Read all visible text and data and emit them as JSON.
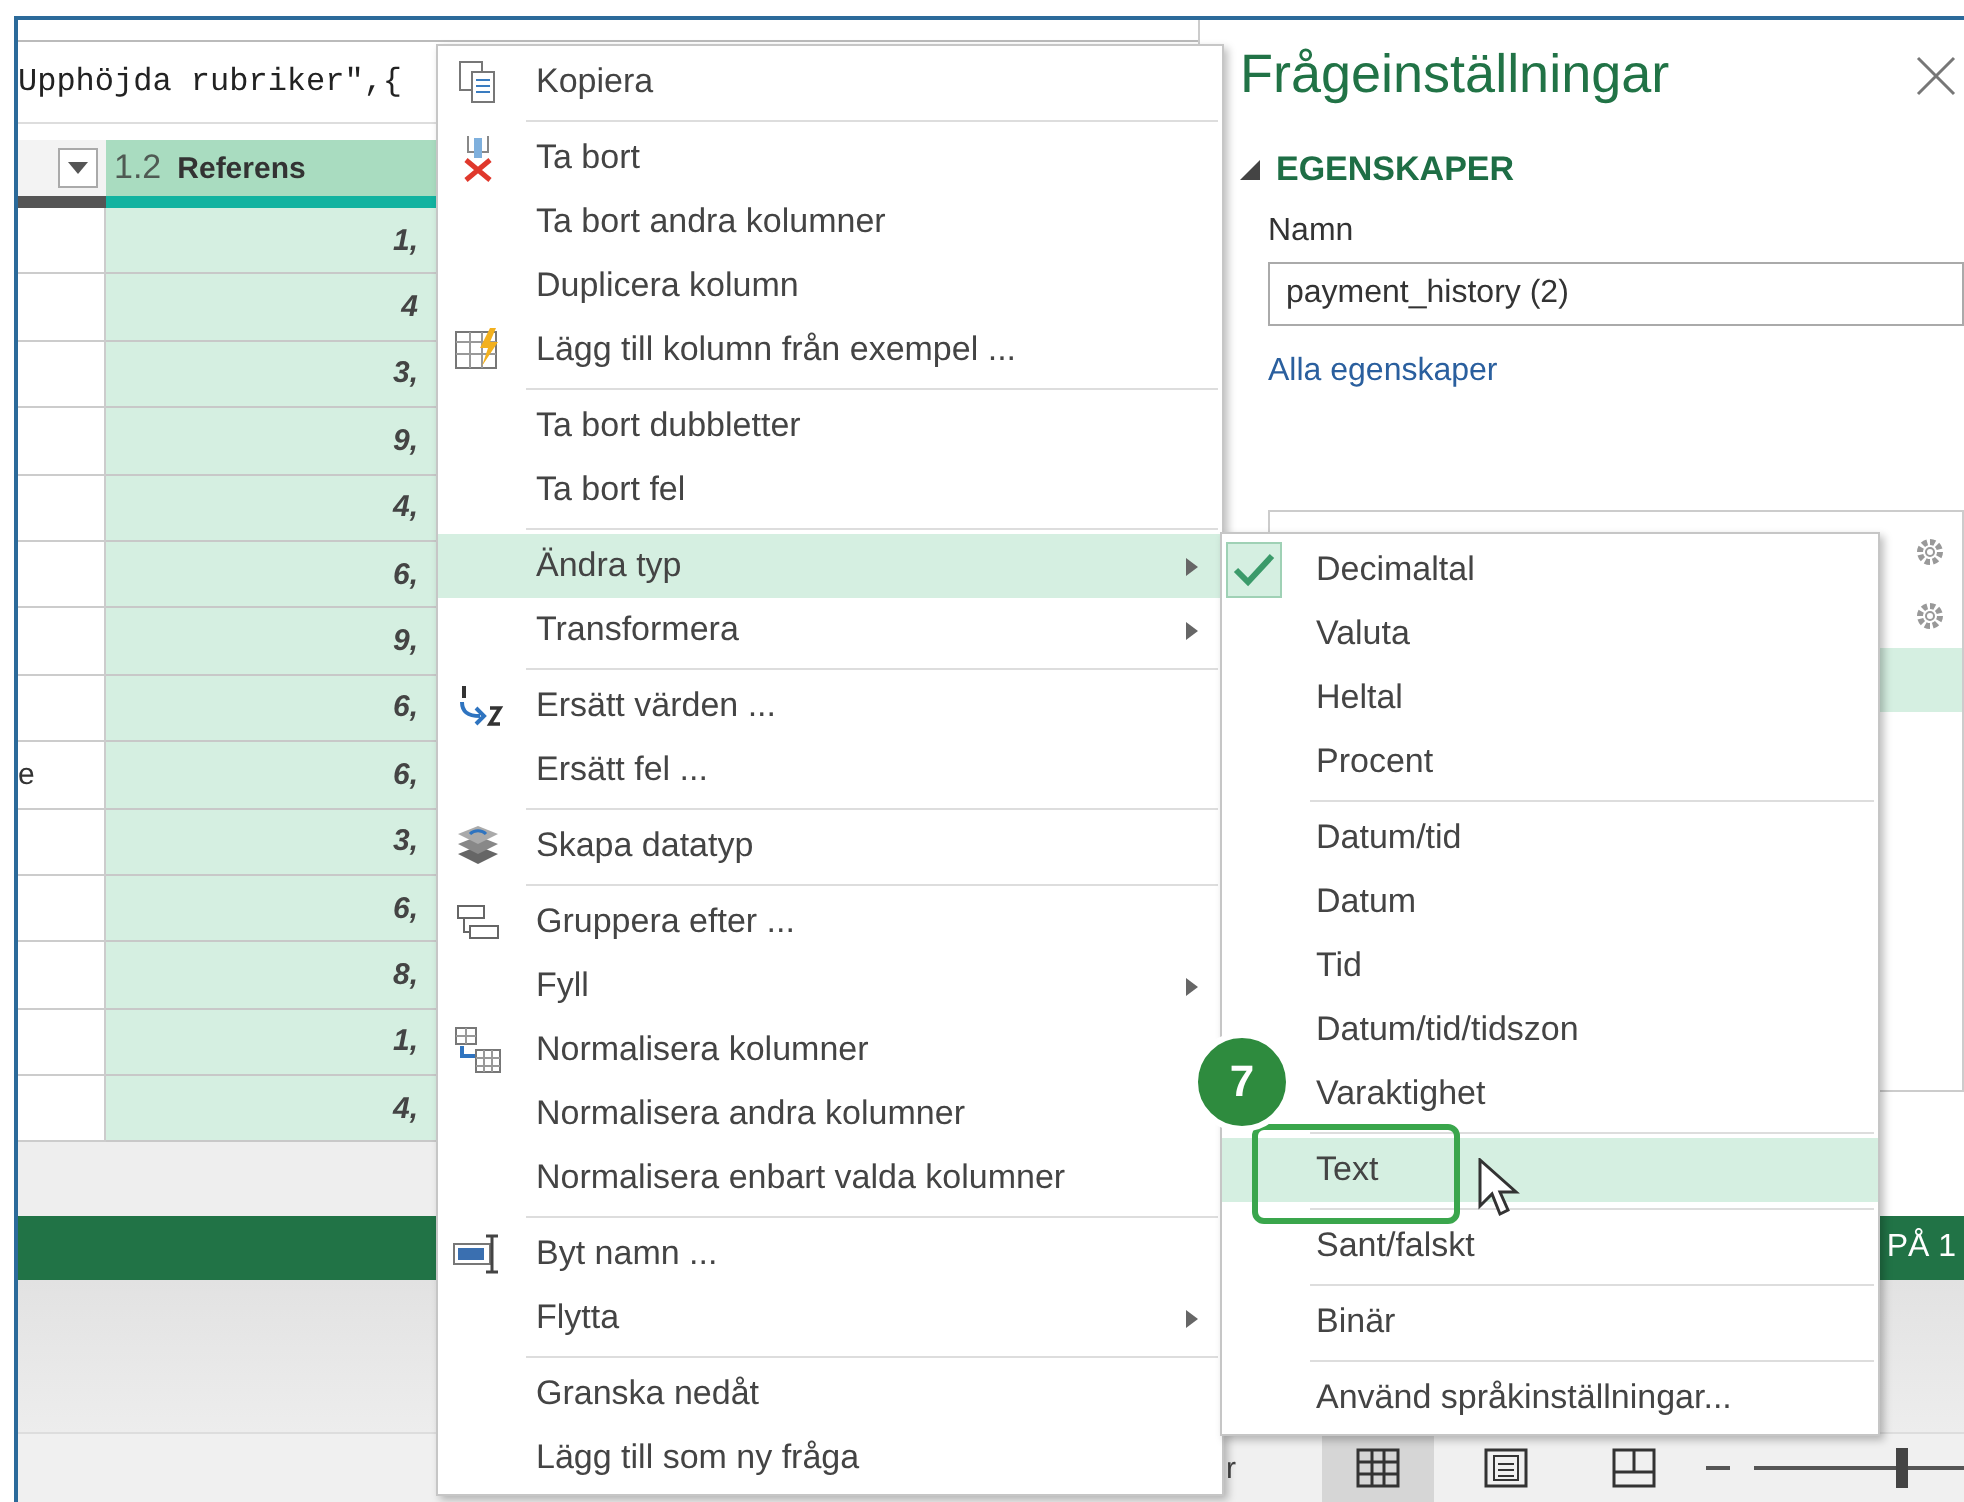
{
  "formula_bar": {
    "text": "Upphöjda rubriker\",{"
  },
  "table": {
    "column_2": {
      "type": "1.2",
      "name": "Referens",
      "selected": true
    },
    "rows": [
      {
        "column_2": "1,"
      },
      {
        "column_2": "4"
      },
      {
        "column_2": "3,"
      },
      {
        "column_2": "9,"
      },
      {
        "column_2": "4,"
      },
      {
        "column_2": "6,"
      },
      {
        "column_2": "9,"
      },
      {
        "column_2": "6,"
      },
      {
        "column_1": "e",
        "column_2": "6,"
      },
      {
        "column_2": "3,"
      },
      {
        "column_2": "6,"
      },
      {
        "column_2": "8,"
      },
      {
        "column_2": "1,"
      },
      {
        "column_2": "4,"
      }
    ]
  },
  "settings_pane": {
    "title": "Frågeinställningar",
    "properties": {
      "heading": "EGENSKAPER",
      "expanded": true,
      "name_label": "Namn",
      "name_value": "payment_history (2)",
      "link": "Alla egenskaper"
    },
    "steps": [
      {
        "has_settings": true,
        "selected": false
      },
      {
        "has_settings": true,
        "selected": false
      },
      {
        "has_settings": false,
        "selected": true
      }
    ]
  },
  "status_bar": {
    "text": "PÅ 1"
  },
  "bottom_bar": {
    "text": "r",
    "views": [
      {
        "selected": true
      },
      {
        "selected": false
      },
      {
        "selected": false
      }
    ],
    "zoom": {
      "level": 0.7
    }
  },
  "context_menu": {
    "items": [
      {
        "kind": "item",
        "label": "Kopiera",
        "icon": true,
        "submenu": false,
        "selected": false
      },
      {
        "kind": "separator"
      },
      {
        "kind": "item",
        "label": "Ta bort",
        "icon": true,
        "submenu": false,
        "selected": false
      },
      {
        "kind": "item",
        "label": "Ta bort andra kolumner",
        "icon": false,
        "submenu": false,
        "selected": false
      },
      {
        "kind": "item",
        "label": "Duplicera kolumn",
        "icon": false,
        "submenu": false,
        "selected": false
      },
      {
        "kind": "item",
        "label": "Lägg till kolumn från exempel ...",
        "icon": true,
        "submenu": false,
        "selected": false
      },
      {
        "kind": "separator"
      },
      {
        "kind": "item",
        "label": "Ta bort dubbletter",
        "icon": false,
        "submenu": false,
        "selected": false
      },
      {
        "kind": "item",
        "label": "Ta bort fel",
        "icon": false,
        "submenu": false,
        "selected": false
      },
      {
        "kind": "separator"
      },
      {
        "kind": "item",
        "label": "Ändra typ",
        "icon": false,
        "submenu": true,
        "selected": true
      },
      {
        "kind": "item",
        "label": "Transformera",
        "icon": false,
        "submenu": true,
        "selected": false
      },
      {
        "kind": "separator"
      },
      {
        "kind": "item",
        "label": "Ersätt värden ...",
        "icon": true,
        "submenu": false,
        "selected": false
      },
      {
        "kind": "item",
        "label": "Ersätt fel ...",
        "icon": false,
        "submenu": false,
        "selected": false
      },
      {
        "kind": "separator"
      },
      {
        "kind": "item",
        "label": "Skapa datatyp",
        "icon": true,
        "submenu": false,
        "selected": false
      },
      {
        "kind": "separator"
      },
      {
        "kind": "item",
        "label": "Gruppera efter ...",
        "icon": true,
        "submenu": false,
        "selected": false
      },
      {
        "kind": "item",
        "label": "Fyll",
        "icon": false,
        "submenu": true,
        "selected": false
      },
      {
        "kind": "item",
        "label": "Normalisera kolumner",
        "icon": true,
        "submenu": false,
        "selected": false
      },
      {
        "kind": "item",
        "label": "Normalisera andra kolumner",
        "icon": false,
        "submenu": false,
        "selected": false
      },
      {
        "kind": "item",
        "label": "Normalisera enbart valda kolumner",
        "icon": false,
        "submenu": false,
        "selected": false
      },
      {
        "kind": "separator"
      },
      {
        "kind": "item",
        "label": "Byt namn ...",
        "icon": true,
        "submenu": false,
        "selected": false
      },
      {
        "kind": "item",
        "label": "Flytta",
        "icon": false,
        "submenu": true,
        "selected": false
      },
      {
        "kind": "separator"
      },
      {
        "kind": "item",
        "label": "Granska nedåt",
        "icon": false,
        "submenu": false,
        "selected": false
      },
      {
        "kind": "item",
        "label": "Lägg till som ny fråga",
        "icon": false,
        "submenu": false,
        "selected": false
      }
    ]
  },
  "submenu": {
    "items": [
      {
        "kind": "item",
        "label": "Decimaltal",
        "checked": true,
        "selected": false
      },
      {
        "kind": "item",
        "label": "Valuta",
        "checked": false,
        "selected": false
      },
      {
        "kind": "item",
        "label": "Heltal",
        "checked": false,
        "selected": false
      },
      {
        "kind": "item",
        "label": "Procent",
        "checked": false,
        "selected": false
      },
      {
        "kind": "separator"
      },
      {
        "kind": "item",
        "label": "Datum/tid",
        "checked": false,
        "selected": false
      },
      {
        "kind": "item",
        "label": "Datum",
        "checked": false,
        "selected": false
      },
      {
        "kind": "item",
        "label": "Tid",
        "checked": false,
        "selected": false
      },
      {
        "kind": "item",
        "label": "Datum/tid/tidszon",
        "checked": false,
        "selected": false
      },
      {
        "kind": "item",
        "label": "Varaktighet",
        "checked": false,
        "selected": false
      },
      {
        "kind": "separator"
      },
      {
        "kind": "item",
        "label": "Text",
        "checked": false,
        "selected": true
      },
      {
        "kind": "separator"
      },
      {
        "kind": "item",
        "label": "Sant/falskt",
        "checked": false,
        "selected": false
      },
      {
        "kind": "separator"
      },
      {
        "kind": "item",
        "label": "Binär",
        "checked": false,
        "selected": false
      },
      {
        "kind": "separator"
      },
      {
        "kind": "item",
        "label": "Använd språkinställningar...",
        "checked": false,
        "selected": false
      }
    ]
  },
  "callout": {
    "number": "7"
  }
}
